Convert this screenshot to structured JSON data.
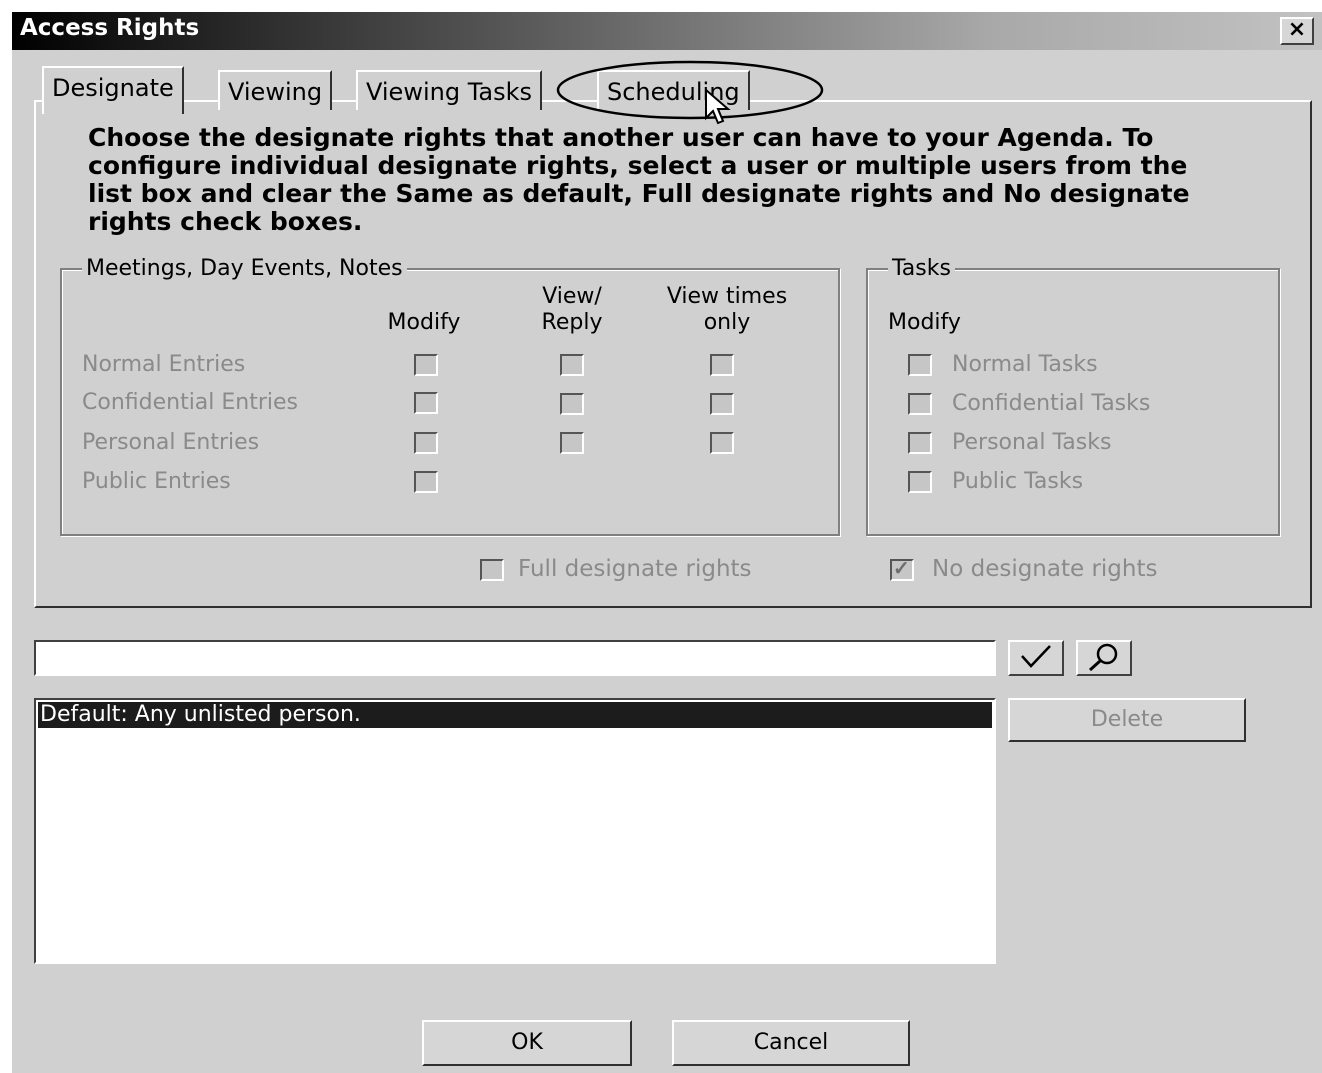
{
  "window": {
    "title": "Access Rights",
    "close_label": "×"
  },
  "tabs": [
    {
      "label": "Designate",
      "active": true
    },
    {
      "label": "Viewing",
      "active": false
    },
    {
      "label": "Viewing Tasks",
      "active": false
    },
    {
      "label": "Scheduling",
      "active": false
    }
  ],
  "intro_text": "Choose the designate rights that another user can have to your Agenda. To configure individual designate rights, select a user or multiple users from the list box and clear the Same as default, Full designate rights and No designate rights check boxes.",
  "meetings_group": {
    "label": "Meetings, Day Events, Notes",
    "col_modify": "Modify",
    "col_view_reply_1": "View/",
    "col_view_reply_2": "Reply",
    "col_view_times_1": "View times",
    "col_view_times_2": "only",
    "rows": [
      {
        "label": "Normal Entries"
      },
      {
        "label": "Confidential Entries"
      },
      {
        "label": "Personal Entries"
      },
      {
        "label": "Public Entries"
      }
    ]
  },
  "tasks_group": {
    "label": "Tasks",
    "col_modify": "Modify",
    "rows": [
      {
        "label": "Normal Tasks"
      },
      {
        "label": "Confidential Tasks"
      },
      {
        "label": "Personal Tasks"
      },
      {
        "label": "Public Tasks"
      }
    ]
  },
  "full_rights": {
    "label": "Full designate rights",
    "checked": false
  },
  "no_rights": {
    "label": "No designate rights",
    "checked": true
  },
  "user_input": {
    "value": ""
  },
  "user_list": {
    "items": [
      "Default: Any unlisted person."
    ]
  },
  "buttons": {
    "delete": "Delete",
    "ok": "OK",
    "cancel": "Cancel"
  }
}
